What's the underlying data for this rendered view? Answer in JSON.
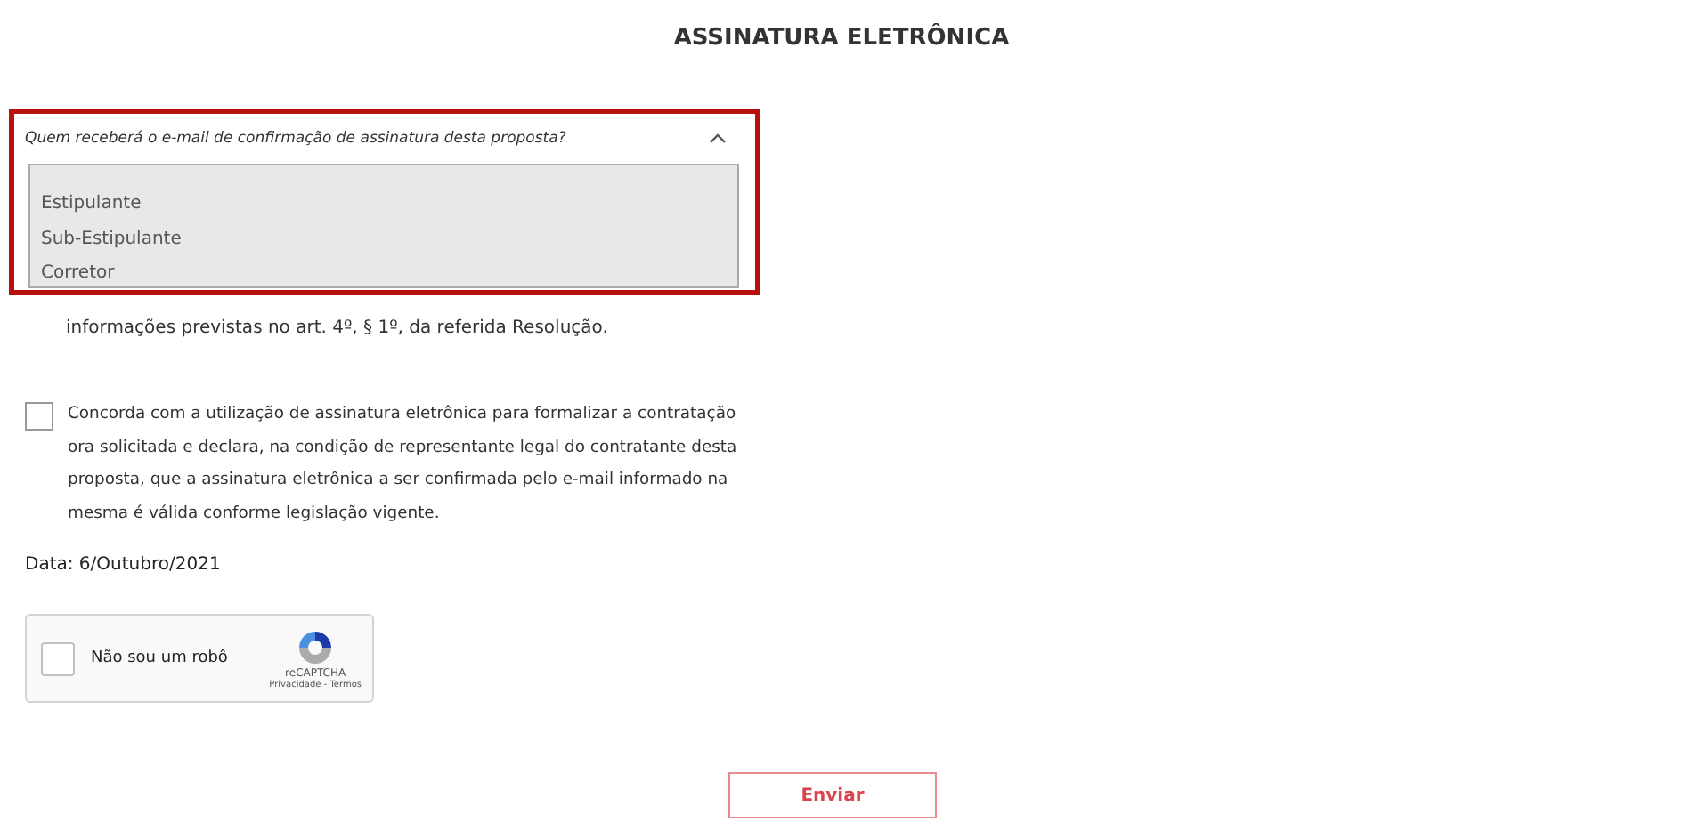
{
  "title": "ASSINATURA ELETRÔNICA",
  "dropdown": {
    "label": "Quem receberá o e-mail de confirmação de assinatura desta proposta?",
    "expanded": true,
    "highlighted": true,
    "options": [
      {
        "label": "Estipulante",
        "selected": false
      },
      {
        "label": "Sub-Estipulante",
        "selected": false
      },
      {
        "label": "Corretor",
        "selected": false
      }
    ]
  },
  "paragraph_tail": "informações previstas no art. 4º, § 1º, da referida Resolução.",
  "consent": {
    "checked": false,
    "text": "Concorda com a utilização de assinatura eletrônica para formalizar a contratação ora solicitada e declara, na condição de representante legal do contratante desta proposta, que a assinatura eletrônica a ser confirmada pelo e-mail informado na mesma é válida conforme legislação vigente."
  },
  "date": "Data: 6/Outubro/2021",
  "captcha": {
    "checked": false,
    "label": "Não sou um robô",
    "brand": "reCAPTCHA",
    "privacy": "Privacidade",
    "separator": "-",
    "terms": "Termos"
  },
  "submit": "Enviar"
}
